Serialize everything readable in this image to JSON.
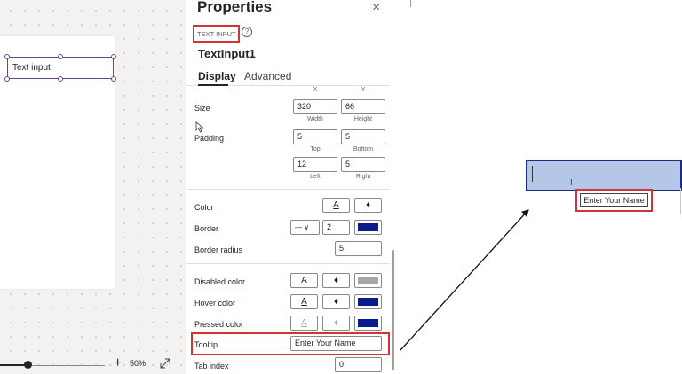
{
  "canvas": {
    "control_text": "Text input",
    "zoom": {
      "level": "50%",
      "plus_icon": "+",
      "expand_icon": "expand-icon"
    }
  },
  "panel": {
    "title": "Properties",
    "close_glyph": "×",
    "control_type": "TEXT INPUT",
    "help_glyph": "?",
    "control_name": "TextInput1",
    "tabs": [
      {
        "label": "Display"
      },
      {
        "label": "Advanced"
      }
    ],
    "position": {
      "x_label": "X",
      "y_label": "Y"
    },
    "size": {
      "label": "Size",
      "width": "320",
      "height": "66",
      "width_label": "Width",
      "height_label": "Height"
    },
    "padding": {
      "label": "Padding",
      "top": "5",
      "bottom": "5",
      "left": "12",
      "right": "5",
      "top_label": "Top",
      "bottom_label": "Bottom",
      "left_label": "Left",
      "right_label": "Right"
    },
    "color": {
      "label": "Color",
      "text_glyph": "A",
      "fill_glyph": "♦"
    },
    "border": {
      "label": "Border",
      "style_glyph": "—",
      "chevron": "∨",
      "width": "2",
      "color": "#0b1b8a"
    },
    "border_radius": {
      "label": "Border radius",
      "value": "5"
    },
    "disabled_color": {
      "label": "Disabled color",
      "text_glyph": "A",
      "fill_glyph": "♦",
      "swatch": "#a6a6a6"
    },
    "hover_color": {
      "label": "Hover color",
      "text_glyph": "A",
      "fill_glyph": "♦",
      "swatch": "#0b1b8a"
    },
    "pressed_color": {
      "label": "Pressed color",
      "text_glyph": "A",
      "fill_glyph": "♦",
      "swatch": "#0b1b8a"
    },
    "tooltip": {
      "label": "Tooltip",
      "value": "Enter Your Name"
    },
    "tab_index": {
      "label": "Tab index",
      "value": "0"
    }
  },
  "preview": {
    "tooltip_text": "Enter Your Name",
    "ibeam_glyph": "I",
    "input_color": "#b4c7e7",
    "border_color": "#1f2a80"
  }
}
